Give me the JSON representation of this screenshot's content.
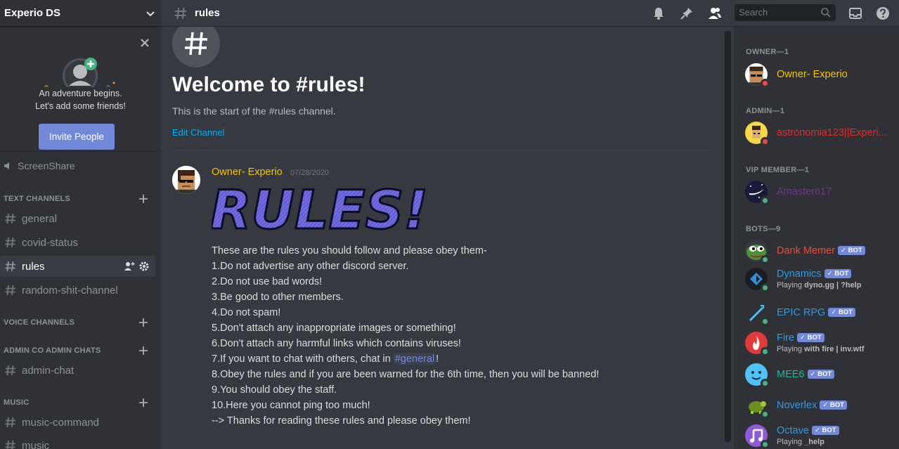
{
  "sidebar": {
    "guild_name": "Experio DS",
    "invite": {
      "line1": "An adventure begins.",
      "line2": "Let's add some friends!",
      "button": "Invite People"
    },
    "screenshare": "ScreenShare",
    "categories": [
      {
        "label": "TEXT CHANNELS"
      },
      {
        "label": "VOICE CHANNELS"
      },
      {
        "label": "ADMIN CO ADMIN CHATS"
      },
      {
        "label": "MUSIC"
      }
    ],
    "channels": [
      {
        "label": "general"
      },
      {
        "label": "covid-status"
      },
      {
        "label": "rules"
      },
      {
        "label": "random-shit-channel"
      },
      {
        "label": "admin-chat"
      },
      {
        "label": "music-command"
      },
      {
        "label": "music"
      }
    ]
  },
  "topbar": {
    "channel": "rules",
    "search_placeholder": "Search"
  },
  "chat": {
    "welcome_title": "Welcome to #rules!",
    "welcome_sub": "This is the start of the #rules channel.",
    "edit_channel": "Edit Channel",
    "message": {
      "author": "Owner- Experio",
      "timestamp": "07/28/2020",
      "banner_text": "RULES!",
      "lines": [
        "These are the rules you should follow and please obey them-",
        "1.Do not advertise any other discord server.",
        "2.Do not use bad words!",
        "3.Be good to other members.",
        "4.Do not spam!",
        "5.Don't attach any inappropriate images or something!",
        "6.Don't attach any harmful links which contains viruses!",
        "7.If you want to chat with others, chat in ",
        "#general",
        "!",
        "8.Obey the rules and if you are been warned for the 6th time, then you will be banned!",
        "9.You should obey the staff.",
        "10.Here you cannot ping too much!",
        "--> Thanks for reading these rules and please obey them!"
      ]
    }
  },
  "members": {
    "groups": [
      {
        "label": "OWNER—1"
      },
      {
        "label": "ADMIN—1"
      },
      {
        "label": "VIP MEMBER—1"
      },
      {
        "label": "BOTS—9"
      }
    ],
    "list": [
      {
        "name": "Owner- Experio",
        "color": "#f1c40f",
        "status": "dnd"
      },
      {
        "name": "astronomia123||Experi...",
        "color": "#e02b2b",
        "status": "dnd"
      },
      {
        "name": "Amaster617",
        "color": "#71368a",
        "status": "online"
      },
      {
        "name": "Dank Memer",
        "color": "#e74c3c",
        "status": "online",
        "bot": "BOT"
      },
      {
        "name": "Dynamics",
        "color": "#3498db",
        "status": "online",
        "bot": "BOT",
        "activity_prefix": "Playing ",
        "activity": "dyno.gg | ?help"
      },
      {
        "name": "EPIC RPG",
        "color": "#3498db",
        "status": "online",
        "bot": "BOT"
      },
      {
        "name": "Fire",
        "color": "#3498db",
        "status": "online",
        "bot": "BOT",
        "activity_prefix": "Playing ",
        "activity": "with fire | inv.wtf"
      },
      {
        "name": "MEE6",
        "color": "#1abc9c",
        "status": "online",
        "bot": "BOT"
      },
      {
        "name": "Noverlex",
        "color": "#3498db",
        "status": "online",
        "bot": "BOT"
      },
      {
        "name": "Octave",
        "color": "#3498db",
        "status": "online",
        "bot": "BOT",
        "activity_prefix": "Playing ",
        "activity": "_help"
      }
    ]
  },
  "colors": {
    "accent": "#7289da",
    "link": "#00b0f4",
    "online": "#43b581",
    "dnd": "#f04747"
  }
}
